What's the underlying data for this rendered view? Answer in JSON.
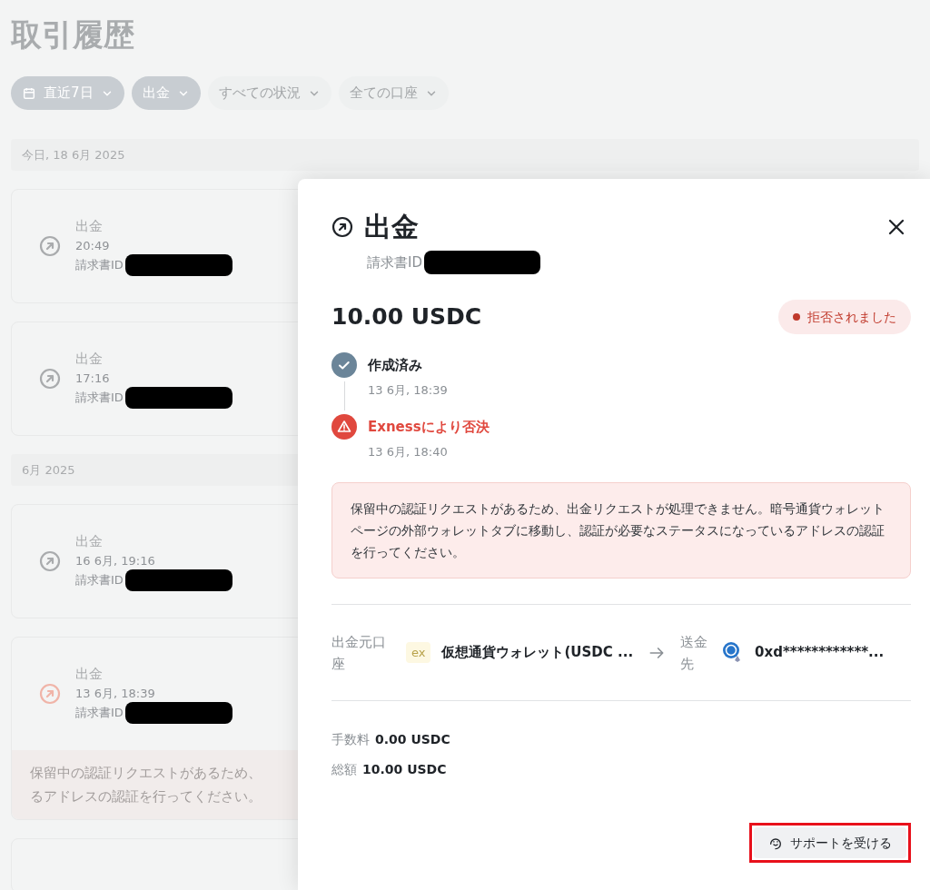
{
  "page_title": "取引履歴",
  "filters": [
    {
      "label": "直近7日",
      "selected": true,
      "kind": "date"
    },
    {
      "label": "出金",
      "selected": true,
      "kind": "select"
    },
    {
      "label": "すべての状況",
      "selected": false,
      "kind": "select"
    },
    {
      "label": "全ての口座",
      "selected": false,
      "kind": "select"
    }
  ],
  "sections": [
    {
      "header": "今日, 18 6月 2025",
      "transactions": [
        {
          "kind": "normal",
          "title": "出金",
          "time": "20:49",
          "id_label": "請求書ID"
        },
        {
          "kind": "normal",
          "title": "出金",
          "time": "17:16",
          "id_label": "請求書ID"
        }
      ]
    },
    {
      "header": "6月 2025",
      "transactions": [
        {
          "kind": "normal",
          "title": "出金",
          "time": "16 6月, 19:16",
          "id_label": "請求書ID"
        },
        {
          "kind": "rejected",
          "title": "出金",
          "time": "13 6月, 18:39",
          "id_label": "請求書ID",
          "message_lines": [
            "保留中の認証リクエストがあるため、",
            "るアドレスの認証を行ってください。"
          ]
        },
        {
          "kind": "partial"
        }
      ]
    }
  ],
  "detail": {
    "title": "出金",
    "id_label": "請求書ID",
    "amount": "10.00 USDC",
    "status": {
      "label": "拒否されました",
      "color": "#c0392b"
    },
    "timeline": [
      {
        "kind": "done",
        "title": "作成済み",
        "time": "13 6月, 18:39"
      },
      {
        "kind": "rejected",
        "title": "Exnessにより否決",
        "time": "13 6月, 18:40"
      }
    ],
    "alert": "保留中の認証リクエストがあるため、出金リクエストが処理できません。暗号通貨ウォレットページの外部ウォレットタブに移動し、認証が必要なステータスになっているアドレスの認証を行ってください。",
    "transfer": {
      "from_label": "出金元口座",
      "from_logo": "ex",
      "from_account": "仮想通貨ウォレット(USDC ...",
      "to_label": "送金先",
      "to_address": "0xd************..."
    },
    "fees": [
      {
        "label": "手数料",
        "value": "0.00 USDC"
      },
      {
        "label": "総額",
        "value": "10.00 USDC"
      }
    ],
    "support_button": "サポートを受ける",
    "highlighted": true
  }
}
